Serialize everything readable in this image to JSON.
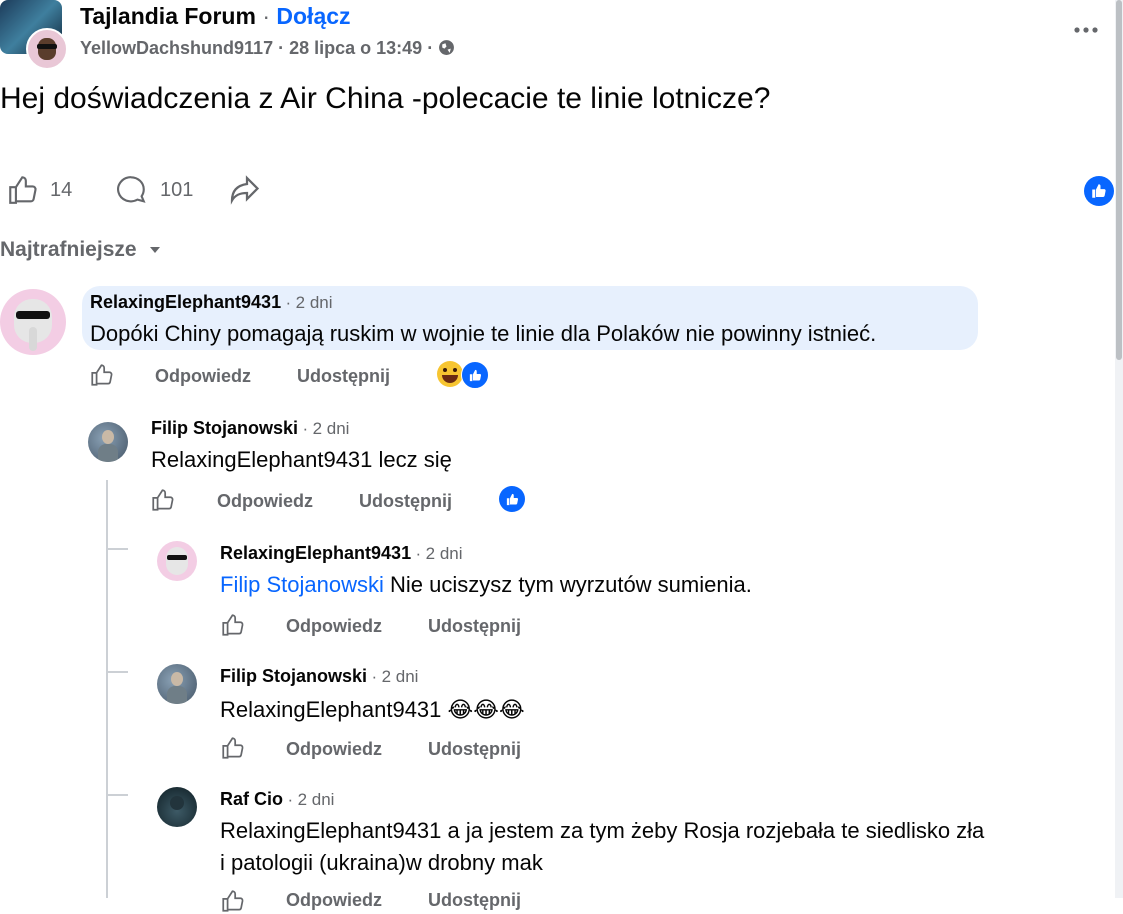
{
  "post": {
    "group_name": "Tajlandia Forum",
    "separator": "·",
    "join_label": "Dołącz",
    "author": "YellowDachshund9117",
    "date": "28 lipca o 13:49",
    "title": "Hej doświadczenia z Air China -polecacie te linie lotnicze?",
    "like_count": "14",
    "comment_count": "101",
    "more_icon": "more-dots-icon",
    "privacy_icon": "globe-icon"
  },
  "sort": {
    "label": "Najtrafniejsze"
  },
  "actions": {
    "reply": "Odpowiedz",
    "share": "Udostępnij"
  },
  "comments": [
    {
      "author": "RelaxingElephant9431",
      "time": "2 dni",
      "text": "Dopóki Chiny pomagają ruskim w wojnie te linie dla Polaków nie powinny istnieć."
    },
    {
      "author": "Filip Stojanowski",
      "time": "2 dni",
      "text": "RelaxingElephant9431 lecz się"
    },
    {
      "author": "RelaxingElephant9431",
      "time": "2 dni",
      "mention": "Filip Stojanowski",
      "text": "Nie uciszysz tym wyrzutów sumienia."
    },
    {
      "author": "Filip Stojanowski",
      "time": "2 dni",
      "text": "RelaxingElephant9431",
      "emoji": "😂😂😂"
    },
    {
      "author": "Raf Cio",
      "time": "2 dni",
      "text_line1": "RelaxingElephant9431 a ja jestem za tym żeby Rosja rozjebała te siedlisko zła",
      "text_line2": "i patologii (ukraina)w drobny mak"
    }
  ],
  "colors": {
    "link": "#0866ff",
    "grey": "#65676b",
    "bubble": "#e7f0fd",
    "like_blue": "#0866ff"
  }
}
